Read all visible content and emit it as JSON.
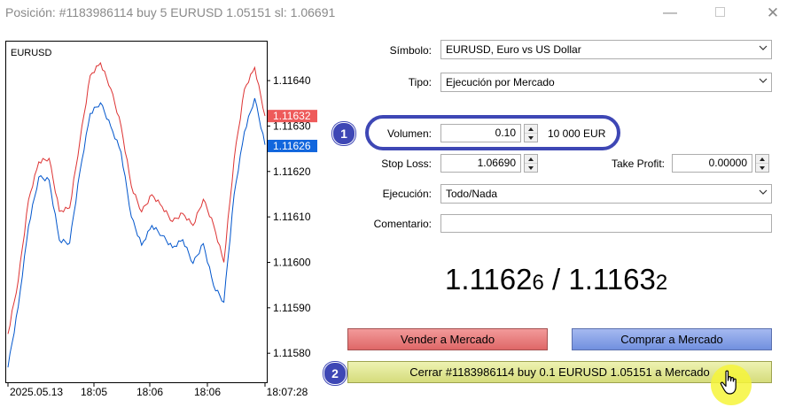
{
  "window": {
    "title": "Posición: #1183986114 buy 5 EURUSD 1.05151 sl: 1.06691",
    "minimize_glyph": "—",
    "close_glyph": "✕"
  },
  "chart": {
    "symbol_label": "EURUSD",
    "bid_line_color": "#0055cc",
    "ask_line_color": "#dd3333",
    "y_ticks": [
      "1.11640",
      "1.11630",
      "1.11620",
      "1.11610",
      "1.11600",
      "1.11590",
      "1.11580"
    ],
    "x_ticks": [
      "2025.05.13",
      "18:05",
      "18:06",
      "18:06",
      "18:07:28"
    ],
    "ask_tag": "1.11632",
    "bid_tag": "1.11626"
  },
  "chart_data": {
    "type": "line",
    "title": "EURUSD",
    "xlabel": "",
    "ylabel": "",
    "x": [
      "2025.05.13",
      "18:05",
      "18:06",
      "18:06",
      "18:07:28"
    ],
    "ylim": [
      1.11574,
      1.11648
    ],
    "y_ticks": [
      1.1164,
      1.1163,
      1.1162,
      1.1161,
      1.116,
      1.1159,
      1.1158
    ],
    "grid": false,
    "series": [
      {
        "color": "#dd3333",
        "values": [
          1.11584,
          1.11596,
          1.11614,
          1.11622,
          1.11623,
          1.11611,
          1.11612,
          1.11627,
          1.11641,
          1.11644,
          1.11638,
          1.1163,
          1.11617,
          1.11611,
          1.11615,
          1.11612,
          1.11609,
          1.11611,
          1.11608,
          1.11614,
          1.11608,
          1.116,
          1.11623,
          1.11638,
          1.11643,
          1.11632
        ]
      },
      {
        "color": "#0055cc",
        "values": [
          1.11577,
          1.1159,
          1.11608,
          1.11619,
          1.11618,
          1.11605,
          1.11604,
          1.1162,
          1.11633,
          1.11635,
          1.1163,
          1.11624,
          1.1161,
          1.11604,
          1.11608,
          1.11606,
          1.11603,
          1.11605,
          1.116,
          1.11604,
          1.11595,
          1.11591,
          1.11615,
          1.11629,
          1.11636,
          1.11626
        ]
      }
    ],
    "last_ask": 1.11632,
    "last_bid": 1.11626
  },
  "form": {
    "symbol_label": "Símbolo:",
    "symbol_value": "EURUSD, Euro vs US Dollar",
    "type_label": "Tipo:",
    "type_value": "Ejecución por Mercado",
    "volume_label": "Volumen:",
    "volume_value": "0.10",
    "volume_note": "10 000 EUR",
    "sl_label": "Stop Loss:",
    "sl_value": "1.06690",
    "tp_label": "Take Profit:",
    "tp_value": "0.00000",
    "execution_label": "Ejecución:",
    "execution_value": "Todo/Nada",
    "comment_label": "Comentario:",
    "comment_value": ""
  },
  "prices": {
    "bid_main": "1.1162",
    "bid_small": "6",
    "separator": " / ",
    "ask_main": "1.1163",
    "ask_small": "2"
  },
  "buttons": {
    "sell": "Vender a Mercado",
    "buy": "Comprar a Mercado",
    "close": "Cerrar #1183986114 buy 0.1 EURUSD 1.05151 a Mercado"
  },
  "badges": {
    "step1": "1",
    "step2": "2"
  },
  "colors": {
    "accent": "#3e47b5",
    "sell": "#e57474",
    "buy": "#7e9be6",
    "close": "#dfe390",
    "cursor_highlight": "#f6f53a"
  }
}
